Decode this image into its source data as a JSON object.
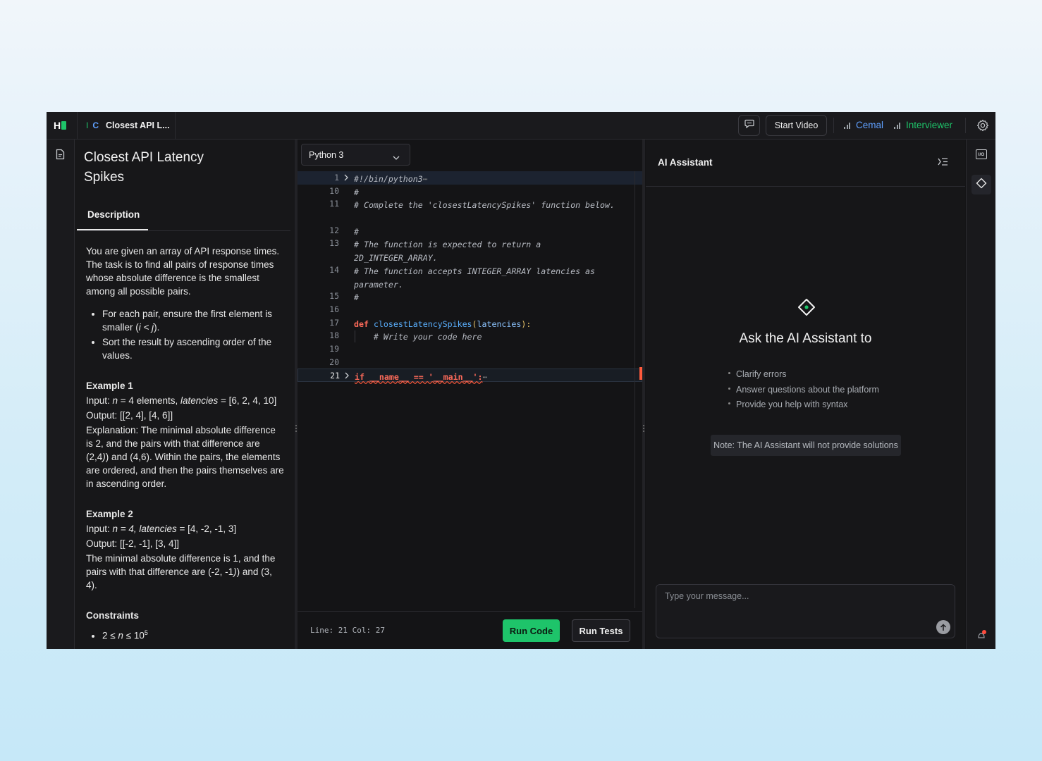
{
  "header": {
    "tab_title": "Closest API L...",
    "tab_prefix_1": "I",
    "tab_prefix_2": "C",
    "start_video": "Start Video",
    "user_1": "Cemal",
    "user_2": "Interviewer",
    "colors": {
      "user_1": "#5fa0ff",
      "user_2": "#1ec46a"
    }
  },
  "problem": {
    "title": "Closest API Latency Spikes",
    "tab": "Description",
    "intro": "You are given an array of API response times. The task is to find all pairs of response times whose absolute difference is the smallest among all possible pairs.",
    "bullet_1_pre": "For each pair, ensure the first element is smaller (",
    "bullet_1_em": "i < j",
    "bullet_1_post": ").",
    "bullet_2": "Sort the result by ascending order of the values.",
    "ex1_title": "Example 1",
    "ex1_input_label": "Input: ",
    "ex1_n": "n",
    "ex1_input_mid": " = 4 elements, ",
    "ex1_lat": "latencies",
    "ex1_input_end": " = [6, 2, 4, 10]",
    "ex1_output": "Output: [[2, 4], [4, 6]]",
    "ex1_expl_1": "Explanation: The minimal absolute difference is 2, and the pairs with that difference are (2,4",
    "ex1_expl_2": ") and (4,6). Within the pairs, the elements are ordered, and then the pairs themselves are in ascending order.",
    "ex2_title": "Example 2",
    "ex2_input_label": "Input: ",
    "ex2_n": "n = 4, latencies",
    "ex2_input_end": " = [4, -2, -1, 3]",
    "ex2_output": "Output: [[-2, -1], [3, 4]]",
    "ex2_expl_1": "The minimal absolute difference is 1, and the pairs with that difference are (-2, -1",
    "ex2_expl_2": ") and (3, 4).",
    "constraints_title": "Constraints",
    "constraint_1_pre": "2 ≤ ",
    "constraint_1_n": "n",
    "constraint_1_mid": " ≤ 10",
    "constraint_1_sup": "5"
  },
  "editor": {
    "language": "Python 3",
    "lines": [
      {
        "num": "1",
        "text": "#!/bin/python3",
        "suffix": "⋯"
      },
      {
        "num": "10",
        "text": "#"
      },
      {
        "num": "11",
        "text": "# Complete the 'closestLatencySpikes' function below."
      },
      {
        "num": "12",
        "text": "#"
      },
      {
        "num": "13",
        "text": "# The function is expected to return a 2D_INTEGER_ARRAY."
      },
      {
        "num": "14",
        "text": "# The function accepts INTEGER_ARRAY latencies as parameter."
      },
      {
        "num": "15",
        "text": "#"
      },
      {
        "num": "16",
        "text": ""
      },
      {
        "num": "17",
        "kw": "def",
        "fn": "closestLatencySpikes",
        "paren_open": "(",
        "param": "latencies",
        "paren_close": "):"
      },
      {
        "num": "18",
        "text": "    # Write your code here"
      },
      {
        "num": "19",
        "text": ""
      },
      {
        "num": "20",
        "text": ""
      },
      {
        "num": "21",
        "code": "if __name__ == '__main__':",
        "suffix": "⋯"
      }
    ],
    "status": "Line: 21 Col: 27",
    "run_code": "Run Code",
    "run_tests": "Run Tests"
  },
  "assistant": {
    "title": "AI Assistant",
    "prompt": "Ask the AI Assistant to",
    "options": [
      "Clarify errors",
      "Answer questions about the platform",
      "Provide you help with syntax"
    ],
    "note": "Note: The AI Assistant will not provide solutions",
    "input_placeholder": "Type your message...",
    "io_label": "I/O"
  }
}
